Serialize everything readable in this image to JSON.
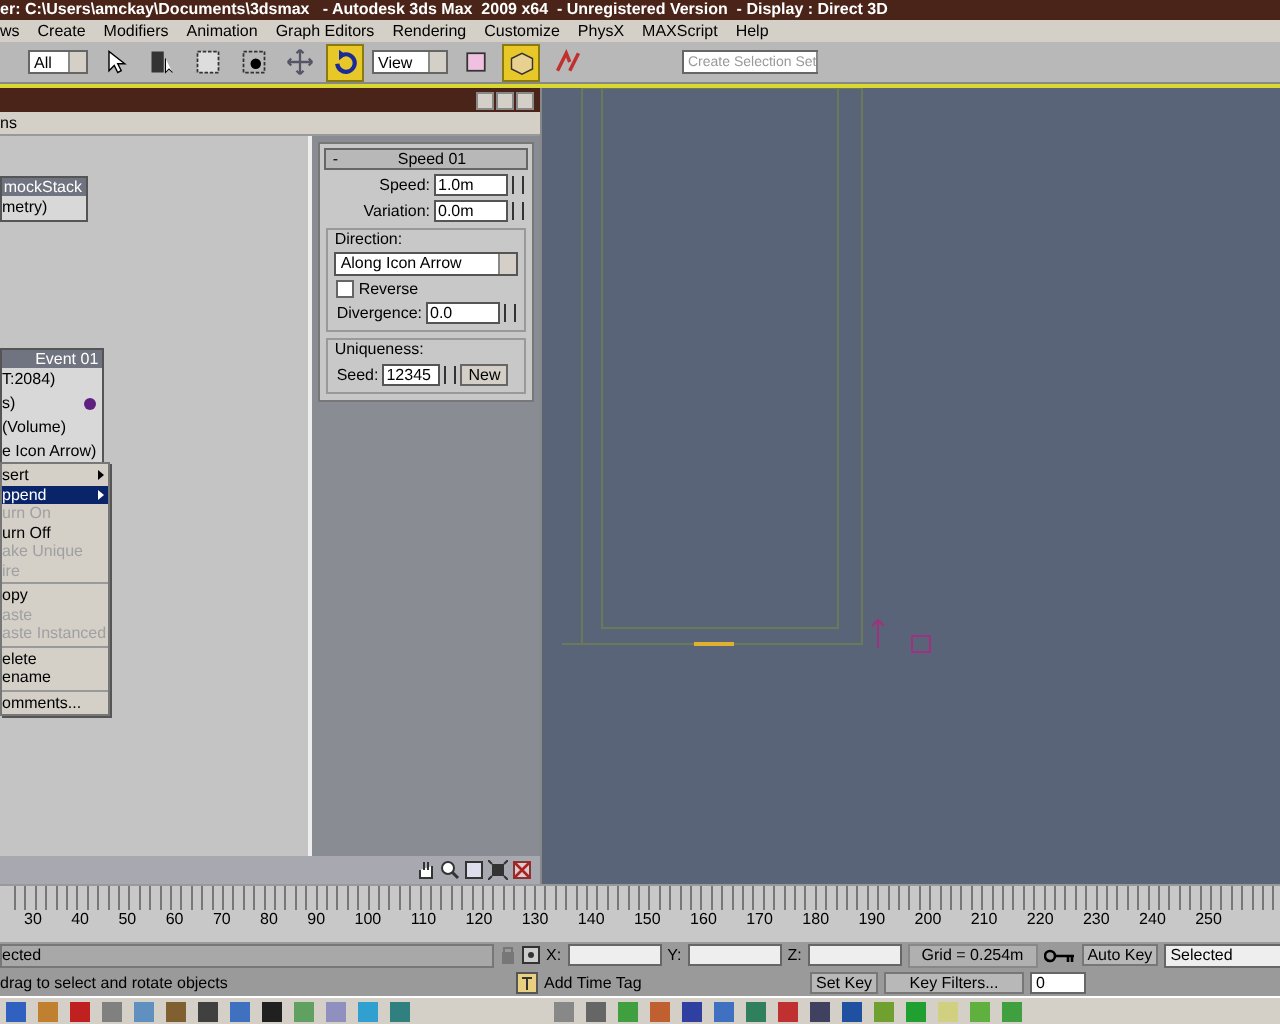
{
  "title_bar": {
    "title": "er: C:\\Users\\amckay\\Documents\\3dsmax   - Autodesk 3ds Max  2009 x64  - Unregistered Version  - Display : Direct 3D"
  },
  "menu": [
    "ws",
    "Create",
    "Modifiers",
    "Animation",
    "Graph Editors",
    "Rendering",
    "Customize",
    "PhysX",
    "MAXScript",
    "Help"
  ],
  "toolbar": {
    "selection_filter": "All",
    "reference_coord": "View",
    "selection_set": "Create Selection Set",
    "tools": [
      {
        "selected": false
      },
      {
        "selected": false
      },
      {
        "selected": false
      },
      {
        "selected": false
      },
      {
        "selected": false
      },
      {
        "selected": true
      },
      {
        "selected": false
      },
      {
        "selected": true
      },
      {
        "selected": false
      }
    ]
  },
  "particle_view": {
    "menu": [
      "ns"
    ],
    "nodes": [
      {
        "header": "mockStack",
        "rows": [
          {
            "label": "metry)",
            "kind": "text"
          }
        ]
      },
      {
        "header": "Event 01",
        "rows": [
          {
            "label": "T:2084)",
            "kind": "text"
          },
          {
            "label": "s)",
            "kind": "light"
          },
          {
            "label": "(Volume)",
            "kind": "text"
          },
          {
            "label": "e Icon Arrow)",
            "kind": "text"
          }
        ]
      }
    ],
    "context_menu": [
      [
        {
          "label": "sert",
          "submenu": true,
          "selected": false,
          "disabled": false
        },
        {
          "label": "ppend",
          "submenu": true,
          "selected": true,
          "disabled": false
        },
        {
          "label": "urn On",
          "submenu": false,
          "selected": false,
          "disabled": true
        },
        {
          "label": "urn Off",
          "submenu": false,
          "selected": false,
          "disabled": false
        },
        {
          "label": "ake Unique",
          "submenu": false,
          "selected": false,
          "disabled": true
        },
        {
          "label": "ire",
          "submenu": false,
          "selected": false,
          "disabled": true
        }
      ],
      [
        {
          "label": "opy",
          "submenu": false,
          "selected": false,
          "disabled": false
        },
        {
          "label": "aste",
          "submenu": false,
          "selected": false,
          "disabled": true
        },
        {
          "label": "aste Instanced",
          "submenu": false,
          "selected": false,
          "disabled": true
        }
      ],
      [
        {
          "label": "elete",
          "submenu": false,
          "selected": false,
          "disabled": false
        },
        {
          "label": "ename",
          "submenu": false,
          "selected": false,
          "disabled": false
        }
      ],
      [
        {
          "label": "omments...",
          "submenu": false,
          "selected": false,
          "disabled": false
        }
      ]
    ],
    "rollout": {
      "collapse": "-",
      "title": "Speed 01",
      "speed_label": "Speed:",
      "speed": "1.0m",
      "variation_label": "Variation:",
      "variation": "0.0m",
      "direction_label": "Direction:",
      "direction": "Along Icon Arrow",
      "reverse": {
        "label": "Reverse",
        "checked": false
      },
      "divergence_label": "Divergence:",
      "divergence": "0.0",
      "uniqueness_label": "Uniqueness:",
      "seed_label": "Seed:",
      "seed": "12345",
      "new_button": "New"
    }
  },
  "timeline": {
    "ticks": [
      "30",
      "40",
      "50",
      "60",
      "70",
      "80",
      "90",
      "100",
      "110",
      "120",
      "130",
      "140",
      "150",
      "160",
      "170",
      "180",
      "190",
      "200",
      "210",
      "220",
      "230",
      "240",
      "250"
    ]
  },
  "status": {
    "selection": "ected",
    "x_label": "X:",
    "y_label": "Y:",
    "z_label": "Z:",
    "grid": "Grid = 0.254m",
    "auto_key": "Auto Key",
    "key_mode": "Selected",
    "prompt": "drag to select and rotate objects",
    "add_time_tag": "Add Time Tag",
    "set_key": "Set Key",
    "key_filters": "Key Filters...",
    "frame": "0"
  }
}
